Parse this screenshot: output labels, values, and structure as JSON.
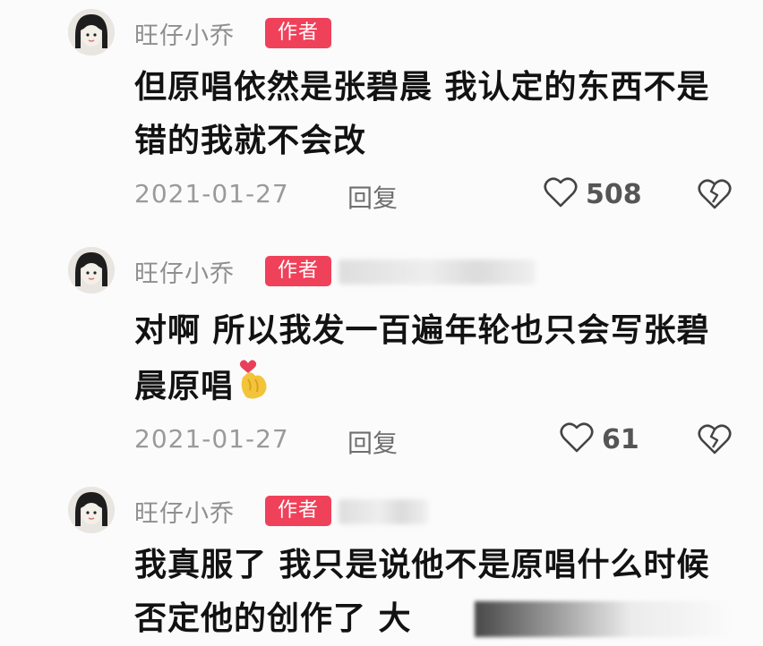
{
  "comments": [
    {
      "username": "旺仔小乔",
      "badge": "作者",
      "text": "但原唱依然是张碧晨 我认定的东西不是错的我就不会改",
      "date": "2021-01-27",
      "reply_label": "回复",
      "likes": "508",
      "emoji": ""
    },
    {
      "username": "旺仔小乔",
      "badge": "作者",
      "text": "对啊 所以我发一百遍年轮也只会写张碧晨原唱",
      "date": "2021-01-27",
      "reply_label": "回复",
      "likes": "61",
      "emoji": "heart-hands-emoji"
    },
    {
      "username": "旺仔小乔",
      "badge": "作者",
      "text": "我真服了 我只是说他不是原唱什么时候否定他的创作了 大",
      "date": "",
      "reply_label": "",
      "likes": "",
      "emoji": ""
    }
  ],
  "colors": {
    "badge": "#f0415a",
    "username": "#8f8f8f",
    "meta": "#9a9a9a",
    "text": "#121212"
  },
  "icons": {
    "like": "heart-outline-icon",
    "dislike": "broken-heart-icon"
  }
}
